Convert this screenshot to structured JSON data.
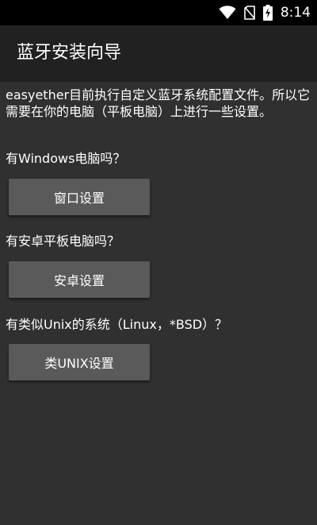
{
  "status_bar": {
    "time": "8:14",
    "icons": [
      "wifi-icon",
      "no-sim-icon",
      "battery-charging-icon"
    ]
  },
  "app_bar": {
    "title": "蓝牙安装向导"
  },
  "content": {
    "intro": "easyether目前执行自定义蓝牙系统配置文件。所以它需要在你的电脑（平板电脑）上进行一些设置。",
    "sections": [
      {
        "question": "有Windows电脑吗？",
        "button_label": "窗口设置"
      },
      {
        "question": "有安卓平板电脑吗？",
        "button_label": "安卓设置"
      },
      {
        "question": "有类似Unix的系统（Linux，*BSD）？",
        "button_label": "类UNIX设置"
      }
    ]
  },
  "colors": {
    "status_bar_bg": "#000000",
    "app_bar_bg": "#212121",
    "content_bg": "#303030",
    "button_bg": "#5a5a5a",
    "text": "#ffffff"
  }
}
